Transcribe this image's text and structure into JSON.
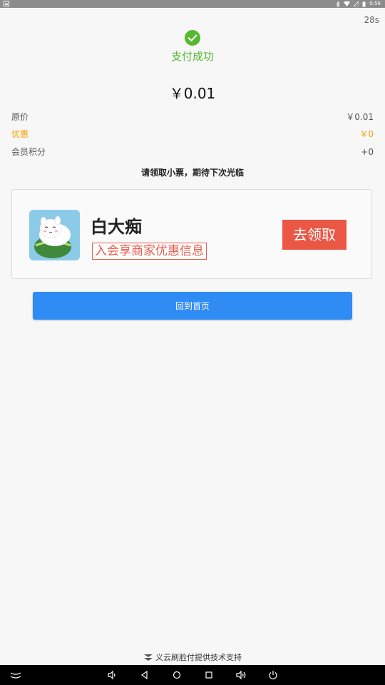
{
  "status_bar": {
    "time": "9:56",
    "icons": [
      "notification-icon",
      "bluetooth-icon",
      "wifi-icon",
      "signal-icon",
      "battery-icon"
    ]
  },
  "countdown": "28s",
  "payment": {
    "status_text": "支付成功",
    "amount": "￥0.01"
  },
  "details": {
    "original_price_label": "原价",
    "original_price_value": "￥0.01",
    "discount_label": "优惠",
    "discount_value": "￥0",
    "points_label": "会员积分",
    "points_value": "+0"
  },
  "notice": "请领取小票，期待下次光临",
  "promo": {
    "title": "白大痴",
    "subtitle": "入会享商家优惠信息",
    "button_label": "去领取"
  },
  "home_button_label": "回到首页",
  "footer_text": "义云刷脸付提供技术支持",
  "colors": {
    "success": "#55b82e",
    "discount": "#f5a300",
    "primary": "#2f8cf5",
    "promo_red": "#ea5845"
  },
  "nav_icons": [
    "collapse-icon",
    "volume-down-icon",
    "back-icon",
    "home-icon",
    "recents-icon",
    "volume-up-icon",
    "power-icon"
  ]
}
